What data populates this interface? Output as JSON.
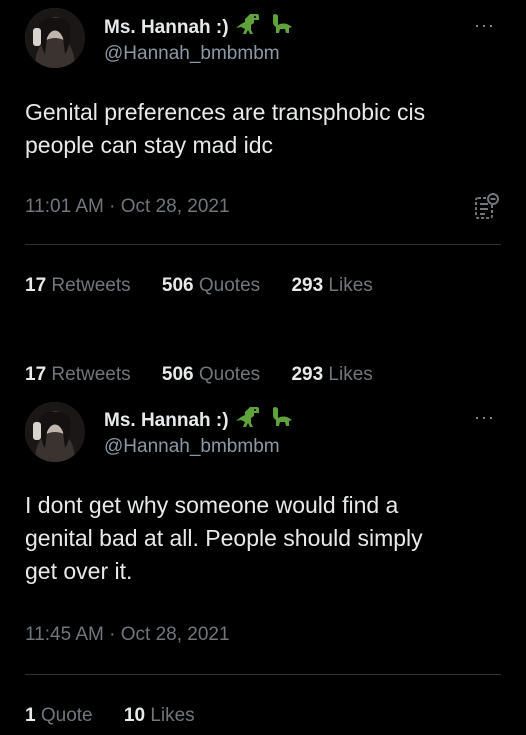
{
  "tweet1": {
    "name": "Ms. Hannah :)",
    "handle": "@Hannah_bmbmbm",
    "more": "···",
    "text_line1": "Genital preferences are transphobic cis",
    "text_line2": "people can stay mad idc",
    "time": "11:01 AM · Oct 28, 2021",
    "stats": [
      {
        "count": "17",
        "label": "Retweets"
      },
      {
        "count": "506",
        "label": "Quotes"
      },
      {
        "count": "293",
        "label": "Likes"
      }
    ]
  },
  "overlap_stats": [
    {
      "count": "17",
      "label": "Retweets"
    },
    {
      "count": "506",
      "label": "Quotes"
    },
    {
      "count": "293",
      "label": "Likes"
    }
  ],
  "tweet2": {
    "name": "Ms. Hannah :)",
    "handle": "@Hannah_bmbmbm",
    "more": "···",
    "text_line1": "I dont get why someone would find a",
    "text_line2": "genital bad at all. People should simply",
    "text_line3": "get over it.",
    "time": "11:45 AM · Oct 28, 2021",
    "stats": [
      {
        "count": "1",
        "label": "Quote"
      },
      {
        "count": "10",
        "label": "Likes"
      }
    ]
  },
  "icons": {
    "dinosaur": "t-rex-icon",
    "sauropod": "sauropod-icon",
    "notes": "notes-icon"
  },
  "colors": {
    "background": "#000000",
    "text": "#e7e9ea",
    "muted": "#71767b",
    "dino_green": "#5fa13a"
  }
}
